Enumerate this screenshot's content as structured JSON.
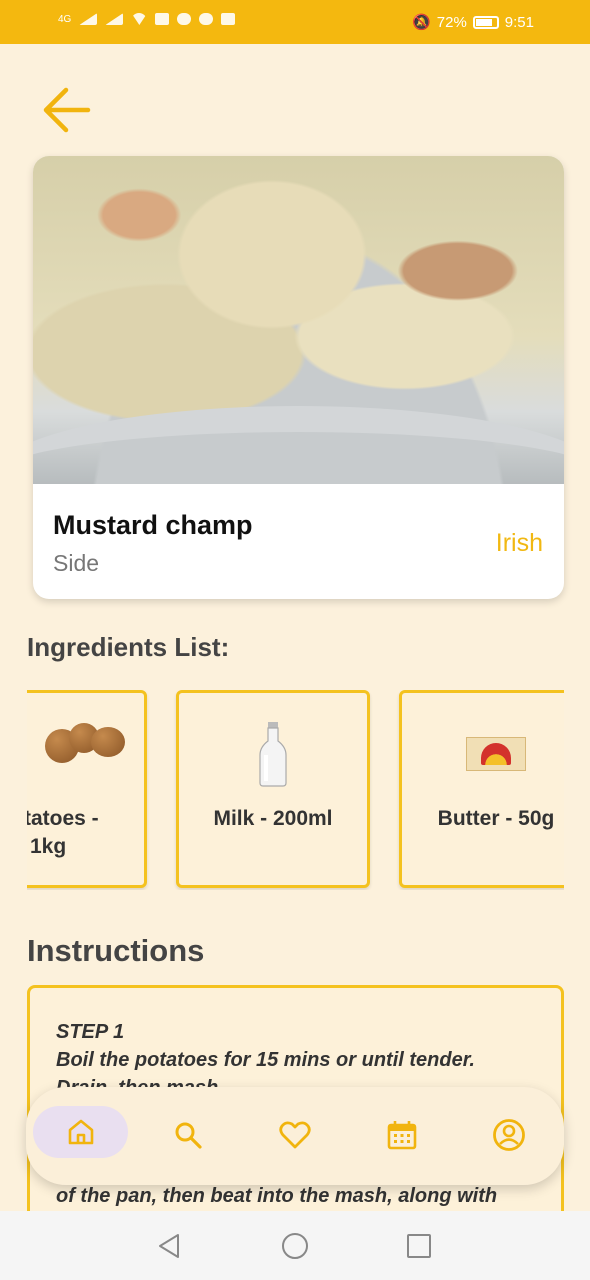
{
  "status_bar": {
    "network": "4G",
    "battery_percent": "72%",
    "time": "9:51"
  },
  "recipe": {
    "name": "Mustard champ",
    "category": "Side",
    "area": "Irish",
    "image_alt": "mustard-mash-photo"
  },
  "ingredients": {
    "title": "Ingredients List:",
    "items": [
      {
        "label": "tatoes - 1kg",
        "line1": "tatoes -",
        "line2": "1kg",
        "icon": "potatoes-icon"
      },
      {
        "label": "Milk - 200ml",
        "icon": "milk-bottle-icon"
      },
      {
        "label": "Butter - 50g",
        "icon": "butter-pack-icon"
      }
    ]
  },
  "instructions": {
    "title": "Instructions",
    "step_heading": "STEP 1",
    "step_text": "Boil the potatoes for 15 mins or until tender.",
    "partial_line": "Drain, then mash.",
    "bottom_line": "of the pan, then beat into the mash, along with"
  },
  "bottom_nav": {
    "items": [
      "home",
      "search",
      "favorites",
      "calendar",
      "profile"
    ],
    "active": "home"
  },
  "colors": {
    "accent": "#f4b80f",
    "background": "#fcf1dc",
    "card_border": "#f4c21f",
    "active_nav_bg": "#e9dff0"
  }
}
